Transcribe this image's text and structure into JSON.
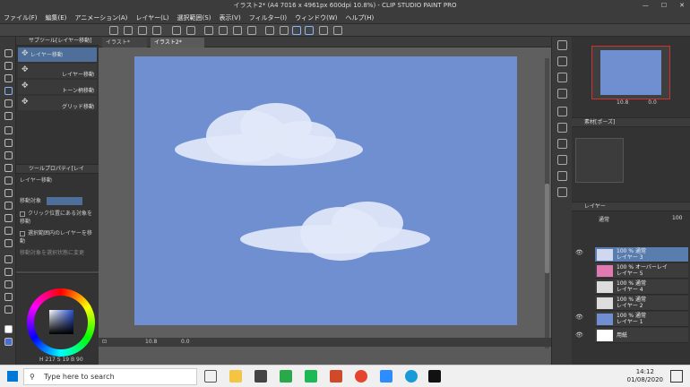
{
  "window": {
    "title": "イラスト2* (A4 7016 x 4961px 600dpi 10.8%) - CLIP STUDIO PAINT PRO"
  },
  "menu": [
    "ファイル(F)",
    "編集(E)",
    "アニメーション(A)",
    "レイヤー(L)",
    "選択範囲(S)",
    "表示(V)",
    "フィルター(I)",
    "ウィンドウ(W)",
    "ヘルプ(H)"
  ],
  "tabs": [
    "イラスト*",
    "イラスト2*"
  ],
  "subtool": {
    "panel_title": "サブツール[レイヤー移動]",
    "items": [
      "レイヤー移動",
      "レイヤー移動",
      "トーン柄移動",
      "グリッド移動"
    ]
  },
  "toolprop": {
    "panel_title": "ツールプロパティ[レイ",
    "heading": "レイヤー移動",
    "target_label": "移動対象",
    "options": [
      "クリック位置にある対象を移動",
      "選択範囲内のレイヤーを移動",
      "移動対象を選択状態に変更"
    ]
  },
  "color": {
    "readout": "H 217 S 19 B 90"
  },
  "canvas": {
    "background": "#6f8fd0"
  },
  "nav": {
    "zoom": "10.8",
    "rotation": "0.0",
    "zoom2": "10.8",
    "rotation2": "0.0"
  },
  "material": {
    "panel_title": "素材[ポーズ]"
  },
  "layers": {
    "panel_title": "レイヤー",
    "blend": "通常",
    "opacity": "100",
    "items": [
      {
        "top": "100 % 通常",
        "name": "レイヤー 3"
      },
      {
        "top": "100 % オーバーレイ",
        "name": "レイヤー 5"
      },
      {
        "top": "100 % 通常",
        "name": "レイヤー 4"
      },
      {
        "top": "100 % 通常",
        "name": "レイヤー 2"
      },
      {
        "top": "100 % 通常",
        "name": "レイヤー 1"
      },
      {
        "top": "",
        "name": "用紙"
      }
    ]
  },
  "taskbar": {
    "search_placeholder": "Type here to search",
    "time": "14:12",
    "date": "01/08/2020"
  }
}
